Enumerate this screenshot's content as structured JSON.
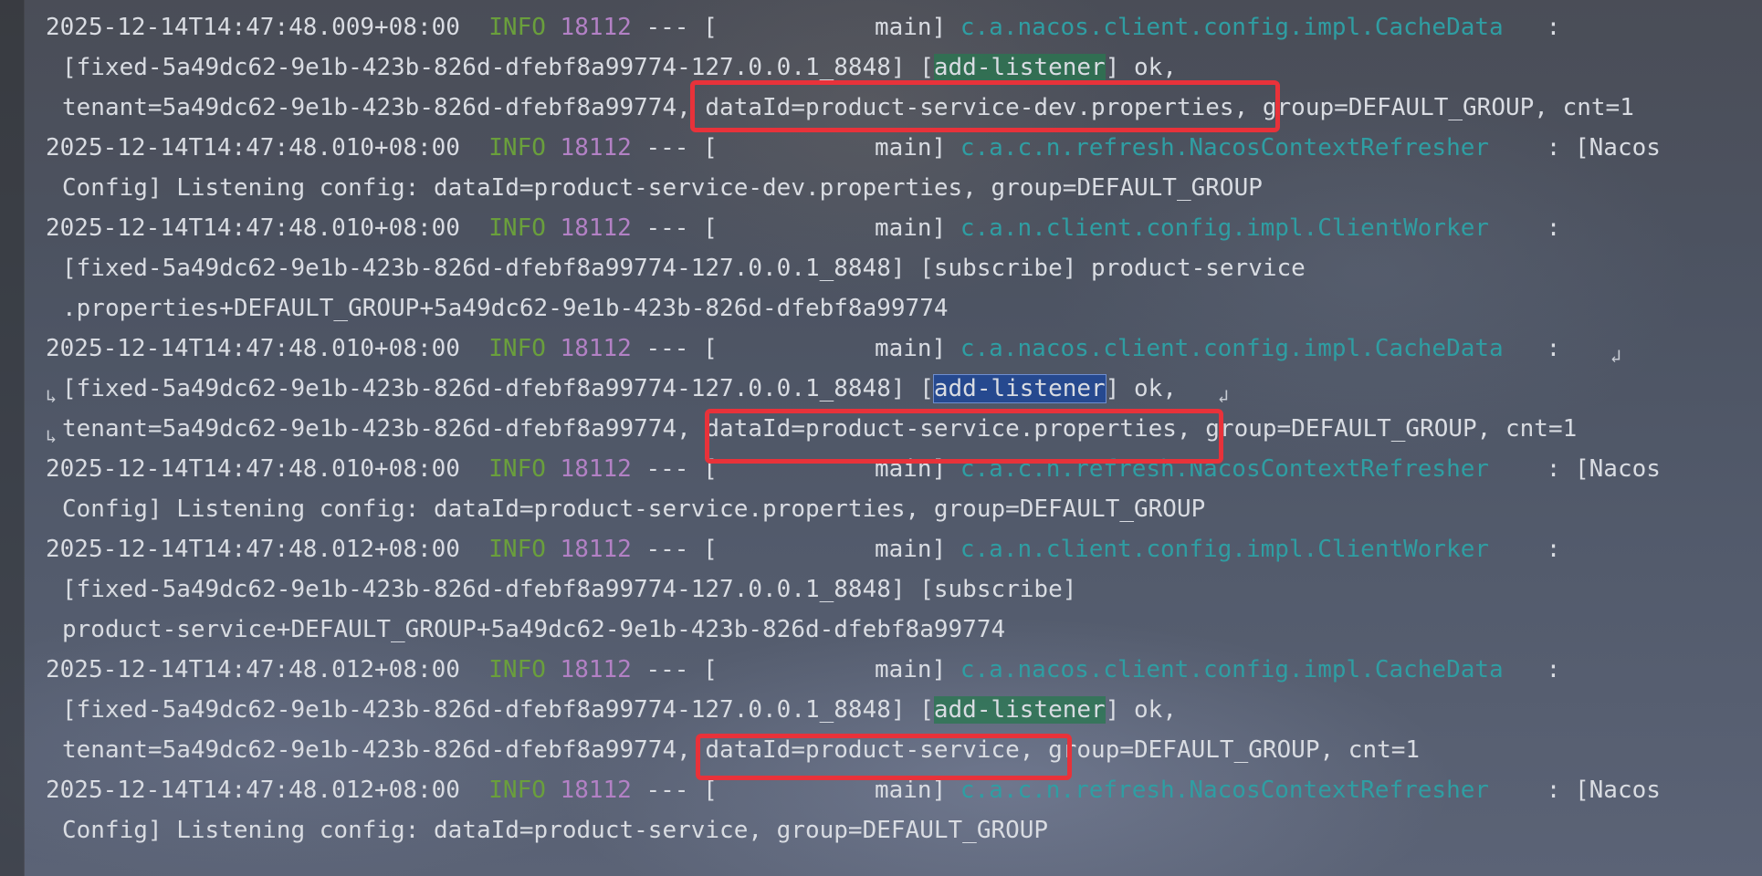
{
  "console": {
    "lines": [
      {
        "ts": "2025-12-14T14:47:48.009+08:00",
        "level": "INFO",
        "pid": "18112",
        "dash": "---",
        "thread": "[           main]",
        "logger": "c.a.nacos.client.config.impl.CacheData",
        "sep": ":",
        "rest": ""
      },
      {
        "text_pre": "[fixed-5a49dc62-9e1b-423b-826d-dfebf8a99774-127.0.0.1_8848] [",
        "highlight": "add-listener",
        "text_post": "] ok,"
      },
      {
        "text": "tenant=5a49dc62-9e1b-423b-826d-dfebf8a99774, dataId=product-service-dev.properties, group=DEFAULT_GROUP, cnt=1"
      },
      {
        "ts": "2025-12-14T14:47:48.010+08:00",
        "level": "INFO",
        "pid": "18112",
        "dash": "---",
        "thread": "[           main]",
        "logger": "c.a.c.n.refresh.NacosContextRefresher",
        "sep": ":",
        "rest": "[Nacos"
      },
      {
        "text": "Config] Listening config: dataId=product-service-dev.properties, group=DEFAULT_GROUP"
      },
      {
        "ts": "2025-12-14T14:47:48.010+08:00",
        "level": "INFO",
        "pid": "18112",
        "dash": "---",
        "thread": "[           main]",
        "logger": "c.a.n.client.config.impl.ClientWorker",
        "sep": ":",
        "rest": ""
      },
      {
        "text": "[fixed-5a49dc62-9e1b-423b-826d-dfebf8a99774-127.0.0.1_8848] [subscribe] product-service"
      },
      {
        "text": ".properties+DEFAULT_GROUP+5a49dc62-9e1b-423b-826d-dfebf8a99774"
      },
      {
        "ts": "2025-12-14T14:47:48.010+08:00",
        "level": "INFO",
        "pid": "18112",
        "dash": "---",
        "thread": "[           main]",
        "logger": "c.a.nacos.client.config.impl.CacheData",
        "sep": ":",
        "rest": ""
      },
      {
        "text_pre": "[fixed-5a49dc62-9e1b-423b-826d-dfebf8a99774-127.0.0.1_8848] [",
        "highlight": "add-listener",
        "text_post": "] ok,"
      },
      {
        "text": "tenant=5a49dc62-9e1b-423b-826d-dfebf8a99774, dataId=product-service.properties, group=DEFAULT_GROUP, cnt=1"
      },
      {
        "ts": "2025-12-14T14:47:48.010+08:00",
        "level": "INFO",
        "pid": "18112",
        "dash": "---",
        "thread": "[           main]",
        "logger": "c.a.c.n.refresh.NacosContextRefresher",
        "sep": ":",
        "rest": "[Nacos"
      },
      {
        "text": "Config] Listening config: dataId=product-service.properties, group=DEFAULT_GROUP"
      },
      {
        "ts": "2025-12-14T14:47:48.012+08:00",
        "level": "INFO",
        "pid": "18112",
        "dash": "---",
        "thread": "[           main]",
        "logger": "c.a.n.client.config.impl.ClientWorker",
        "sep": ":",
        "rest": ""
      },
      {
        "text": "[fixed-5a49dc62-9e1b-423b-826d-dfebf8a99774-127.0.0.1_8848] [subscribe]"
      },
      {
        "text": "product-service+DEFAULT_GROUP+5a49dc62-9e1b-423b-826d-dfebf8a99774"
      },
      {
        "ts": "2025-12-14T14:47:48.012+08:00",
        "level": "INFO",
        "pid": "18112",
        "dash": "---",
        "thread": "[           main]",
        "logger": "c.a.nacos.client.config.impl.CacheData",
        "sep": ":",
        "rest": ""
      },
      {
        "text_pre": "[fixed-5a49dc62-9e1b-423b-826d-dfebf8a99774-127.0.0.1_8848] [",
        "highlight": "add-listener",
        "text_post": "] ok,"
      },
      {
        "text": "tenant=5a49dc62-9e1b-423b-826d-dfebf8a99774, dataId=product-service, group=DEFAULT_GROUP, cnt=1"
      },
      {
        "ts": "2025-12-14T14:47:48.012+08:00",
        "level": "INFO",
        "pid": "18112",
        "dash": "---",
        "thread": "[           main]",
        "logger": "c.a.c.n.refresh.NacosContextRefresher",
        "sep": ":",
        "rest": "[Nacos"
      },
      {
        "text": "Config] Listening config: dataId=product-service, group=DEFAULT_GROUP"
      }
    ]
  },
  "colors": {
    "info": "#6a9f3c",
    "pid": "#b381c5",
    "logger": "#2f9ea3",
    "annotation_box": "#e8323a"
  },
  "icons": {
    "soft_wrap_end": "soft-wrap-end-icon",
    "soft_wrap_start": "soft-wrap-start-icon"
  }
}
